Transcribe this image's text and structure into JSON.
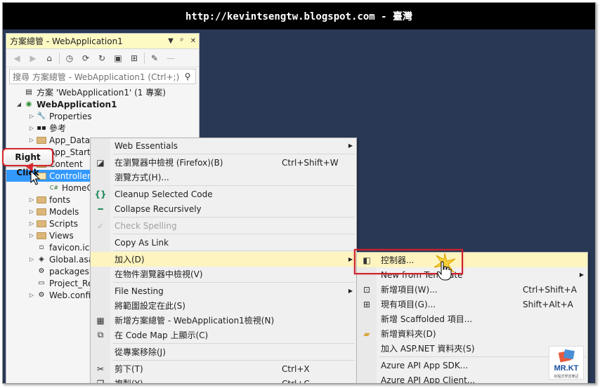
{
  "banner": {
    "text": "http://kevintsengtw.blogspot.com - 臺灣"
  },
  "solution_explorer": {
    "title": "方案總管 - WebApplication1",
    "title_buttons": [
      "▼",
      "ᵖ",
      "✕"
    ],
    "search_placeholder": "搜尋 方案總管 - WebApplication1 (Ctrl+;)",
    "tree": [
      {
        "label": "方案 'WebApplication1' (1 專案)",
        "icon": "solution-icon",
        "arrow": "",
        "indent": 0
      },
      {
        "label": "WebApplication1",
        "icon": "web-project-icon",
        "arrow": "expanded",
        "indent": 0,
        "bold": true
      },
      {
        "label": "Properties",
        "icon": "wrench-icon",
        "arrow": "collapsed",
        "indent": 1
      },
      {
        "label": "參考",
        "icon": "references-icon",
        "arrow": "collapsed",
        "indent": 1
      },
      {
        "label": "App_Data",
        "icon": "folder-icon",
        "arrow": "collapsed",
        "indent": 1
      },
      {
        "label": "App_Start",
        "icon": "folder-icon",
        "arrow": "collapsed",
        "indent": 1
      },
      {
        "label": "Content",
        "icon": "folder-icon",
        "arrow": "collapsed",
        "indent": 1
      },
      {
        "label": "Controllers",
        "icon": "folder-icon",
        "arrow": "expanded",
        "indent": 1,
        "selected": true
      },
      {
        "label": "HomeController.cs",
        "icon": "csharp-file-icon",
        "arrow": "",
        "indent": 2
      },
      {
        "label": "fonts",
        "icon": "folder-icon",
        "arrow": "collapsed",
        "indent": 1
      },
      {
        "label": "Models",
        "icon": "folder-icon",
        "arrow": "collapsed",
        "indent": 1
      },
      {
        "label": "Scripts",
        "icon": "folder-icon",
        "arrow": "collapsed",
        "indent": 1
      },
      {
        "label": "Views",
        "icon": "folder-icon",
        "arrow": "collapsed",
        "indent": 1
      },
      {
        "label": "favicon.ico",
        "icon": "file-icon",
        "arrow": "",
        "indent": 1
      },
      {
        "label": "Global.asax",
        "icon": "global-icon",
        "arrow": "collapsed",
        "indent": 1
      },
      {
        "label": "packages.config",
        "icon": "config-icon",
        "arrow": "",
        "indent": 1
      },
      {
        "label": "Project_Readme.html",
        "icon": "html-file-icon",
        "arrow": "",
        "indent": 1
      },
      {
        "label": "Web.config",
        "icon": "config-icon",
        "arrow": "collapsed",
        "indent": 1
      }
    ]
  },
  "callout": {
    "text": "Right Click"
  },
  "context_menu": {
    "items": [
      {
        "label": "Web Essentials",
        "shortcut": "",
        "submenu": true,
        "icon": ""
      },
      "sep",
      {
        "label": "在瀏覽器中檢視 (Firefox)(B)",
        "shortcut": "Ctrl+Shift+W",
        "icon": "browser-icon"
      },
      {
        "label": "瀏覽方式(H)...",
        "shortcut": "",
        "icon": ""
      },
      "sep",
      {
        "label": "Cleanup Selected Code",
        "shortcut": "",
        "icon": "braces-icon"
      },
      {
        "label": "Collapse Recursively",
        "shortcut": "",
        "icon": "dash-icon"
      },
      "sep",
      {
        "label": "Check Spelling",
        "shortcut": "",
        "icon": "spelling-icon",
        "disabled": true
      },
      "sep",
      {
        "label": "Copy As Link",
        "shortcut": "",
        "icon": ""
      },
      "sep",
      {
        "label": "加入(D)",
        "shortcut": "",
        "submenu": true,
        "highlight": true,
        "icon": ""
      },
      {
        "label": "在物件瀏覽器中檢視(V)",
        "shortcut": "",
        "icon": ""
      },
      "sep",
      {
        "label": "File Nesting",
        "shortcut": "",
        "submenu": true,
        "icon": ""
      },
      {
        "label": "將範圍設定在此(S)",
        "shortcut": "",
        "icon": ""
      },
      {
        "label": "新增方案總管 - WebApplication1檢視(N)",
        "shortcut": "",
        "icon": "new-view-icon"
      },
      {
        "label": "在 Code Map 上顯示(C)",
        "shortcut": "",
        "icon": "codemap-icon"
      },
      "sep",
      {
        "label": "從專案移除(J)",
        "shortcut": "",
        "icon": ""
      },
      "sep",
      {
        "label": "剪下(T)",
        "shortcut": "Ctrl+X",
        "icon": "scissors-icon"
      },
      {
        "label": "複製(Y)",
        "shortcut": "Ctrl+C",
        "icon": "copy-icon"
      }
    ]
  },
  "submenu": {
    "items": [
      {
        "label": "控制器...",
        "shortcut": "",
        "icon": "controller-icon",
        "highlight": true
      },
      {
        "label": "New from Template",
        "shortcut": "",
        "submenu": true,
        "icon": ""
      },
      {
        "label": "新增項目(W)...",
        "shortcut": "Ctrl+Shift+A",
        "icon": "new-item-icon"
      },
      {
        "label": "現有項目(G)...",
        "shortcut": "Shift+Alt+A",
        "icon": "existing-item-icon"
      },
      {
        "label": "新增 Scaffolded 項目...",
        "shortcut": "",
        "icon": ""
      },
      {
        "label": "新增資料夾(D)",
        "shortcut": "",
        "icon": "new-folder-icon"
      },
      {
        "label": "加入 ASP.NET 資料夾(S)",
        "shortcut": "",
        "submenu": true,
        "icon": ""
      },
      "sep",
      {
        "label": "Azure API App SDK...",
        "shortcut": "",
        "icon": ""
      },
      {
        "label": "Azure API App Client...",
        "shortcut": "",
        "icon": ""
      }
    ]
  },
  "logo": {
    "text": "MR.KT",
    "sub": "的程式學習筆記"
  }
}
